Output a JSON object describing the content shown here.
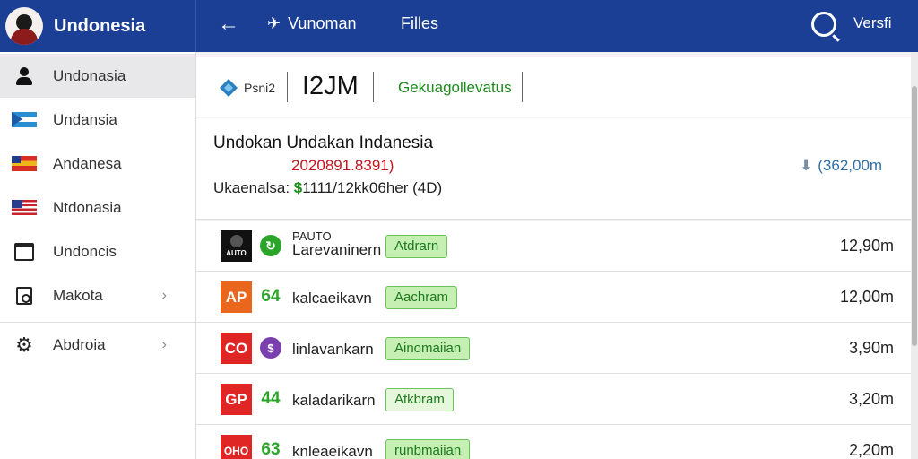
{
  "header": {
    "brand_title": "Undonesia",
    "nav": [
      {
        "label": "Vunoman",
        "icon": "plane-icon"
      },
      {
        "label": "Filles"
      }
    ],
    "version_label": "Versfi"
  },
  "sidebar": {
    "items": [
      {
        "label": "Undonasia",
        "icon": "person-icon",
        "active": true
      },
      {
        "label": "Undansia",
        "icon": "flag-icon"
      },
      {
        "label": "Andanesa",
        "icon": "flag-icon"
      },
      {
        "label": "Ntdonasia",
        "icon": "flag-icon"
      },
      {
        "label": "Undoncis",
        "icon": "window-icon"
      },
      {
        "label": "Makota",
        "icon": "box-icon",
        "chevron": "›"
      },
      {
        "label": "Abdroia",
        "icon": "gear-icon",
        "chevron": "›"
      }
    ]
  },
  "toolbar": {
    "small_label": "Psni2",
    "big_value": "I2JM",
    "green_label": "Gekuagollevatus"
  },
  "summary": {
    "title": "Undokan Undakan Indanesia",
    "code": "2020891.8391)",
    "line_label": "Ukaenalsa:",
    "line_amount": "$",
    "line_rest": "1111/12kk06her (4D)",
    "right_value": "(362,00m"
  },
  "rows": [
    {
      "logo": "AUTO",
      "name_top": "PAUTO",
      "name_bottom": "Larevaninern",
      "badge": "Atdrarn",
      "size": "12,90m"
    },
    {
      "logo": "AP",
      "num": "64",
      "name": "kalcaeikavn",
      "badge": "Aachram",
      "size": "12,00m"
    },
    {
      "logo": "CO",
      "name": "linlavankarn",
      "badge": "Ainomaiian",
      "size": "3,90m"
    },
    {
      "logo": "GP",
      "num": "44",
      "name": "kaladarikarn",
      "badge": "Atkbram",
      "size": "3,20m"
    },
    {
      "logo": "OHO",
      "num": "63",
      "name": "knleaeikavn",
      "badge": "runbmaiian",
      "size": "2,20m"
    }
  ],
  "colors": {
    "header_bg": "#1b3f95",
    "badge_green": "#c6efb4",
    "code_red": "#c4141c",
    "amount_green": "#1a8e1a"
  }
}
